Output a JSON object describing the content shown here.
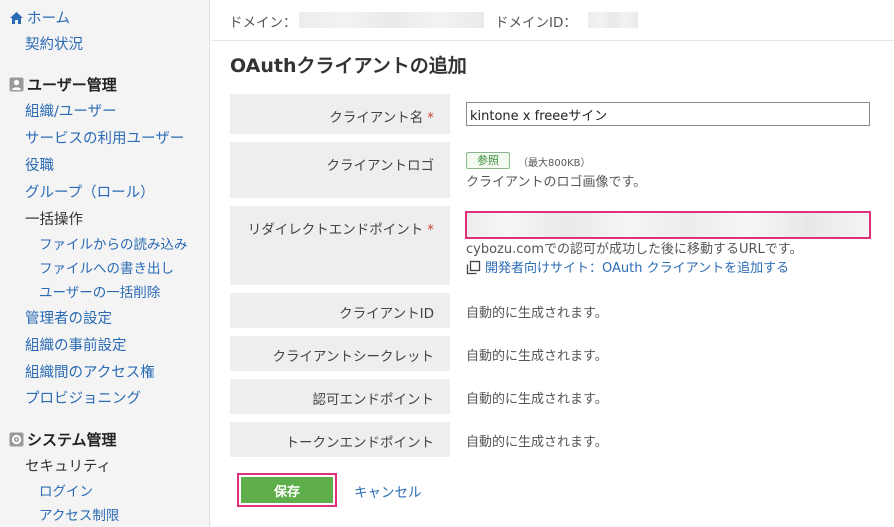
{
  "sidebar": {
    "home": "ホーム",
    "contract": "契約状況",
    "user_mgmt": "ユーザー管理",
    "org_users": "組織/ユーザー",
    "service_users": "サービスの利用ユーザー",
    "roles": "役職",
    "groups": "グループ（ロール）",
    "bulk": "一括操作",
    "import_file": "ファイルからの読み込み",
    "export_file": "ファイルへの書き出し",
    "bulk_delete": "ユーザーの一括削除",
    "admin_settings": "管理者の設定",
    "org_pre": "組織の事前設定",
    "org_access": "組織間のアクセス権",
    "provisioning": "プロビジョニング",
    "system_mgmt": "システム管理",
    "security": "セキュリティ",
    "login": "ログイン",
    "access_limit": "アクセス制限"
  },
  "header": {
    "domain_label": "ドメイン：",
    "domain_id_label": "ドメインID："
  },
  "page": {
    "title": "OAuthクライアントの追加"
  },
  "form": {
    "client_name_label": "クライアント名",
    "required_mark": "*",
    "client_name_value": "kintone x freeeサイン",
    "client_logo_label": "クライアントロゴ",
    "browse_label": "参照",
    "max_size": "（最大800KB）",
    "logo_hint": "クライアントのロゴ画像です。",
    "redirect_label": "リダイレクトエンドポイント",
    "redirect_hint": "cybozu.comでの認可が成功した後に移動するURLです。",
    "dev_link": "開発者向けサイト：OAuth クライアントを追加する",
    "client_id_label": "クライアントID",
    "client_secret_label": "クライアントシークレット",
    "auth_endpoint_label": "認可エンドポイント",
    "token_endpoint_label": "トークンエンドポイント",
    "auto_generated": "自動的に生成されます。"
  },
  "actions": {
    "save": "保存",
    "cancel": "キャンセル"
  },
  "colors": {
    "link": "#2b6bb5",
    "save": "#5fae4c",
    "highlight": "#e0307a"
  }
}
